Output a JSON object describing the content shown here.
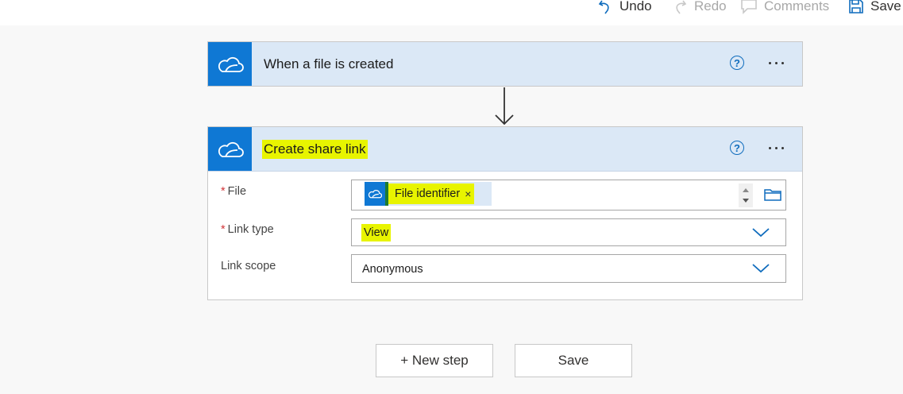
{
  "toolbar": {
    "undo_label": "Undo",
    "redo_label": "Redo",
    "comments_label": "Comments",
    "save_label": "Save"
  },
  "trigger_card": {
    "title": "When a file is created",
    "help_glyph": "?",
    "icon": "onedrive-cloud-icon"
  },
  "action_card": {
    "title": "Create share link",
    "help_glyph": "?",
    "icon": "onedrive-cloud-icon",
    "fields": {
      "file": {
        "label": "File",
        "required_mark": "*",
        "token_label": "File identifier",
        "token_remove": "×"
      },
      "link_type": {
        "label": "Link type",
        "required_mark": "*",
        "value": "View"
      },
      "link_scope": {
        "label": "Link scope",
        "value": "Anonymous"
      }
    }
  },
  "footer": {
    "new_step_label": "+ New step",
    "save_label": "Save"
  },
  "colors": {
    "accent": "#0f78d4",
    "header_bg": "#dbe8f6",
    "highlight": "#e8f400",
    "required": "#d13438"
  }
}
